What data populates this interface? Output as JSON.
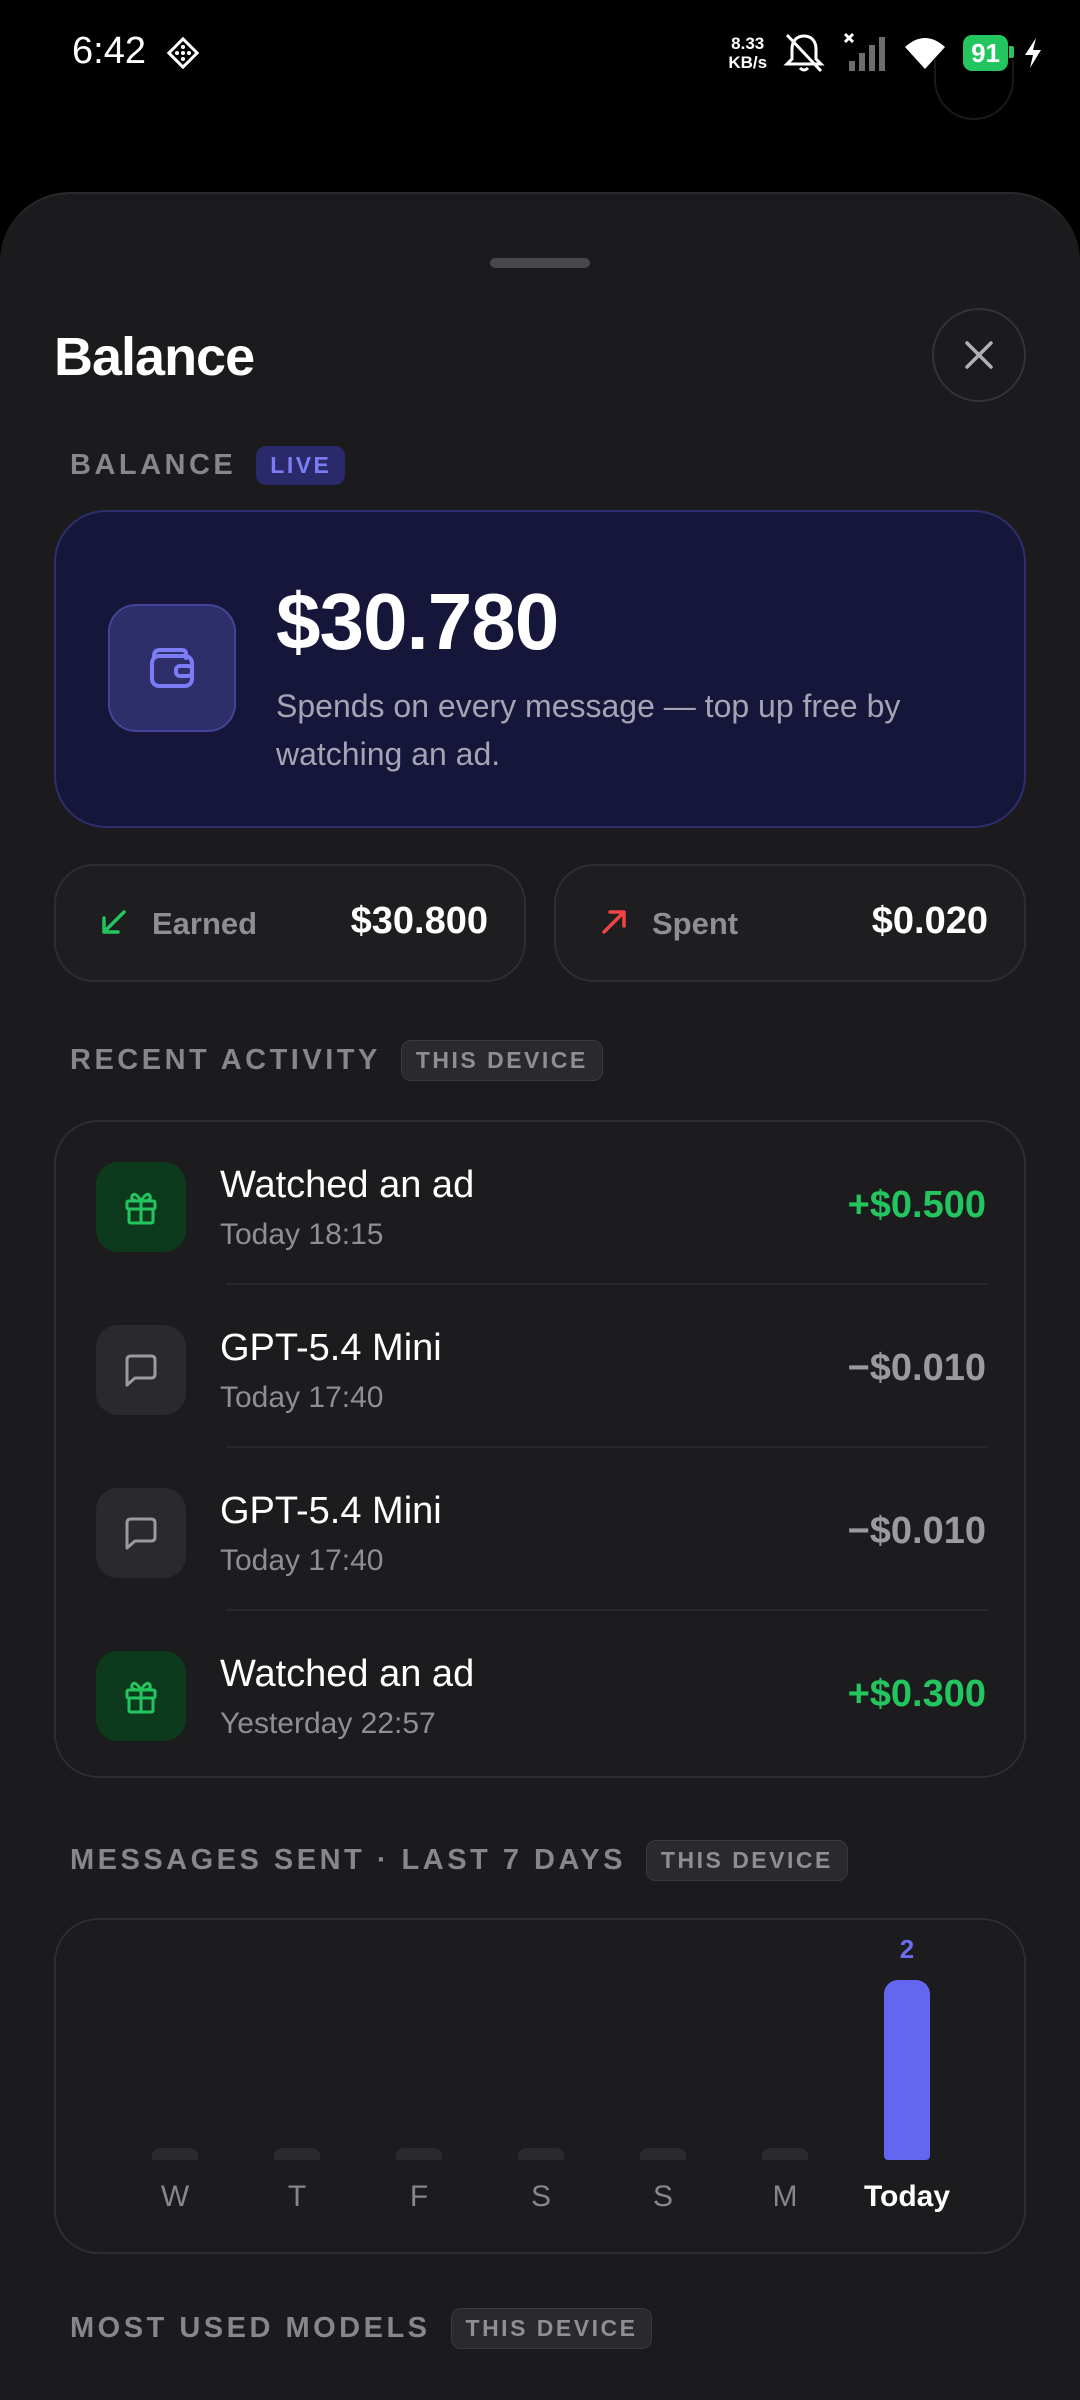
{
  "status_bar": {
    "time": "6:42",
    "net_speed_value": "8.33",
    "net_speed_unit": "KB/s",
    "battery": "91"
  },
  "sheet": {
    "title": "Balance",
    "close_icon": "close-icon"
  },
  "balance": {
    "section_label": "BALANCE",
    "live_chip": "LIVE",
    "amount": "$30.780",
    "subtitle": "Spends on every message — top up free by watching an ad.",
    "icon": "wallet-icon"
  },
  "stats": {
    "earned_label": "Earned",
    "earned_value": "$30.800",
    "spent_label": "Spent",
    "spent_value": "$0.020"
  },
  "activity": {
    "section_label": "RECENT ACTIVITY",
    "chip": "THIS DEVICE",
    "items": [
      {
        "title": "Watched an ad",
        "time": "Today 18:15",
        "amount": "+$0.500",
        "icon": "gift-icon",
        "type": "credit"
      },
      {
        "title": "GPT-5.4 Mini",
        "time": "Today 17:40",
        "amount": "−$0.010",
        "icon": "message-icon",
        "type": "debit"
      },
      {
        "title": "GPT-5.4 Mini",
        "time": "Today 17:40",
        "amount": "−$0.010",
        "icon": "message-icon",
        "type": "debit"
      },
      {
        "title": "Watched an ad",
        "time": "Yesterday 22:57",
        "amount": "+$0.300",
        "icon": "gift-icon",
        "type": "credit"
      }
    ]
  },
  "messages_chart": {
    "section_label": "MESSAGES SENT · LAST 7 DAYS",
    "chip": "THIS DEVICE"
  },
  "chart_data": {
    "type": "bar",
    "categories": [
      "W",
      "T",
      "F",
      "S",
      "S",
      "M",
      "Today"
    ],
    "values": [
      0,
      0,
      0,
      0,
      0,
      0,
      2
    ],
    "data_labels": [
      "",
      "",
      "",
      "",
      "",
      "",
      "2"
    ],
    "title": "",
    "xlabel": "",
    "ylabel": "",
    "ylim": [
      0,
      2
    ],
    "grid": false,
    "bar_color": "#6366f1",
    "highlight_category": "Today"
  },
  "most_used": {
    "section_label": "MOST USED MODELS",
    "chip": "THIS DEVICE"
  },
  "colors": {
    "accent": "#6366f1",
    "positive": "#22c55e",
    "negative": "#ef4444",
    "sheet_bg": "#1b1b1d"
  }
}
